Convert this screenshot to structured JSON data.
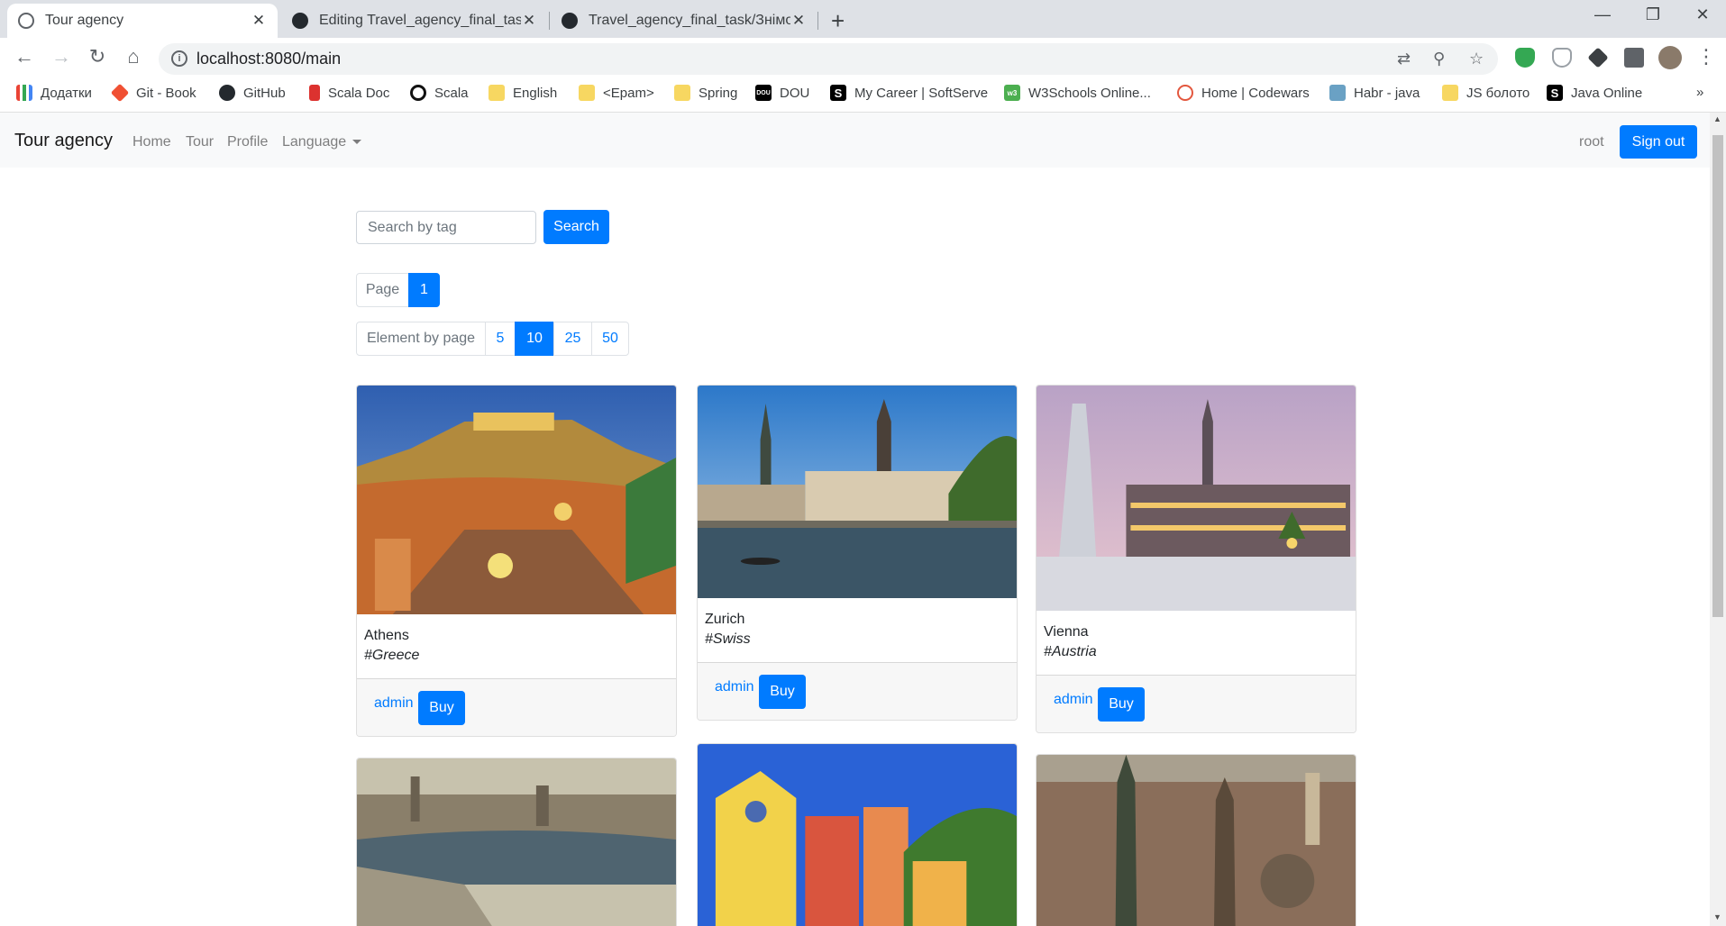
{
  "browser": {
    "tabs": [
      {
        "title": "Tour agency",
        "active": true
      },
      {
        "title": "Editing Travel_agency_final_task/",
        "active": false
      },
      {
        "title": "Travel_agency_final_task/Знімок",
        "active": false
      }
    ],
    "url": "localhost:8080/main",
    "bookmarks": [
      {
        "label": "Додатки",
        "icon": "apps-grid-icon"
      },
      {
        "label": "Git - Book",
        "icon": "git-icon"
      },
      {
        "label": "GitHub",
        "icon": "github-icon"
      },
      {
        "label": "Scala Doc",
        "icon": "scala-icon"
      },
      {
        "label": "Scala",
        "icon": "scala-circle-icon"
      },
      {
        "label": "English",
        "icon": "folder-icon"
      },
      {
        "label": "<Epam>",
        "icon": "folder-icon"
      },
      {
        "label": "Spring",
        "icon": "folder-icon"
      },
      {
        "label": "DOU",
        "icon": "dou-icon"
      },
      {
        "label": "My Career | SoftServe",
        "icon": "softserve-icon"
      },
      {
        "label": "W3Schools Online...",
        "icon": "w3schools-icon"
      },
      {
        "label": "Home | Codewars",
        "icon": "codewars-icon"
      },
      {
        "label": "Habr - java",
        "icon": "habr-icon"
      },
      {
        "label": "JS болото",
        "icon": "folder-icon"
      },
      {
        "label": "Java Online",
        "icon": "java-online-icon"
      }
    ],
    "more_bookmarks": "»"
  },
  "navbar": {
    "brand": "Tour agency",
    "links": [
      "Home",
      "Tour",
      "Profile"
    ],
    "language": "Language",
    "username": "root",
    "signout": "Sign out"
  },
  "search": {
    "placeholder": "Search by tag",
    "button": "Search"
  },
  "pagination": {
    "label": "Page",
    "pages": [
      "1"
    ],
    "current_page": "1"
  },
  "page_size": {
    "label": "Element by page",
    "options": [
      "5",
      "10",
      "25",
      "50"
    ],
    "selected": "10"
  },
  "tours": [
    {
      "city": "Athens",
      "tag": "#Greece",
      "author": "admin",
      "buy": "Buy"
    },
    {
      "city": "Zurich",
      "tag": "#Swiss",
      "author": "admin",
      "buy": "Buy"
    },
    {
      "city": "Vienna",
      "tag": "#Austria",
      "author": "admin",
      "buy": "Buy"
    },
    {
      "city": "",
      "tag": "",
      "author": "",
      "buy": ""
    },
    {
      "city": "",
      "tag": "",
      "author": "",
      "buy": ""
    },
    {
      "city": "",
      "tag": "",
      "author": "",
      "buy": ""
    }
  ],
  "colors": {
    "primary": "#007bff",
    "navbar_bg": "#f8f9fa",
    "tabstrip_bg": "#dee1e6"
  }
}
